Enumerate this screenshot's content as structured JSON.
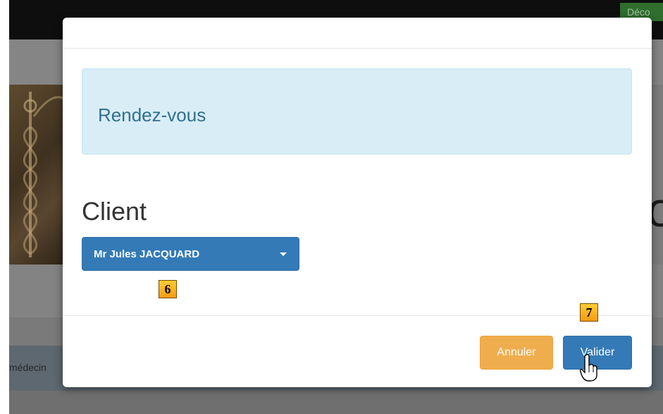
{
  "background": {
    "logout_label": "Déco",
    "partial_letter": "o",
    "partial_text": "médecin"
  },
  "modal": {
    "alert_title": "Rendez-vous",
    "client_label": "Client",
    "client_select": {
      "selected_value": "Mr Jules JACQUARD"
    },
    "buttons": {
      "cancel_label": "Annuler",
      "submit_label": "Valider"
    }
  },
  "markers": {
    "marker_6": "6",
    "marker_7": "7"
  },
  "colors": {
    "primary": "#337ab7",
    "warning": "#f0ad4e",
    "info_bg": "#d9edf7",
    "info_text": "#31708f",
    "marker": "#f39c12"
  }
}
